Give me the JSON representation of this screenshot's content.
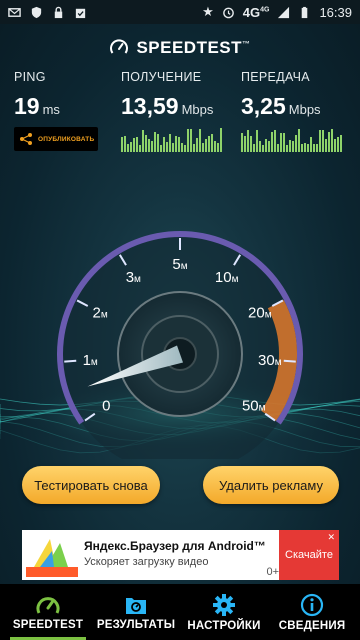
{
  "status_bar": {
    "time": "16:39",
    "network": "4G",
    "network_sup": "4G"
  },
  "app": {
    "brand": "SPEEDTEST",
    "brand_tm": "™"
  },
  "metrics": {
    "ping": {
      "label": "PING",
      "value": "19",
      "unit": "ms"
    },
    "download": {
      "label": "ПОЛУЧЕНИЕ",
      "value": "13,59",
      "unit": "Mbps"
    },
    "upload": {
      "label": "ПЕРЕДАЧА",
      "value": "3,25",
      "unit": "Mbps"
    }
  },
  "share_button": {
    "label": "ОПУБЛИКОВАТЬ"
  },
  "gauge": {
    "ticks": [
      "0",
      "1м",
      "2м",
      "3м",
      "5м",
      "10м",
      "20м",
      "30м",
      "50м"
    ],
    "tick_labels": [
      "0",
      "1",
      "2",
      "3",
      "5",
      "10",
      "20",
      "30",
      "50"
    ],
    "tick_suffix": "м",
    "needle_value_mbps": 0.5,
    "colors": {
      "arc": "#5c4fa0",
      "accent": "#e07a2c"
    }
  },
  "buttons": {
    "retest": "Тестировать снова",
    "remove_ads": "Удалить рекламу"
  },
  "ad": {
    "title": "Яндекс.Браузер для Android™",
    "subtitle": "Ускоряет загрузку видео",
    "cta": "Скачайте",
    "badge": "0+"
  },
  "nav": {
    "items": [
      {
        "label": "SPEEDTEST",
        "icon": "gauge-icon"
      },
      {
        "label": "РЕЗУЛЬТАТЫ",
        "icon": "results-icon"
      },
      {
        "label": "НАСТРОЙКИ",
        "icon": "gear-icon"
      },
      {
        "label": "СВЕДЕНИЯ",
        "icon": "info-icon"
      }
    ]
  }
}
